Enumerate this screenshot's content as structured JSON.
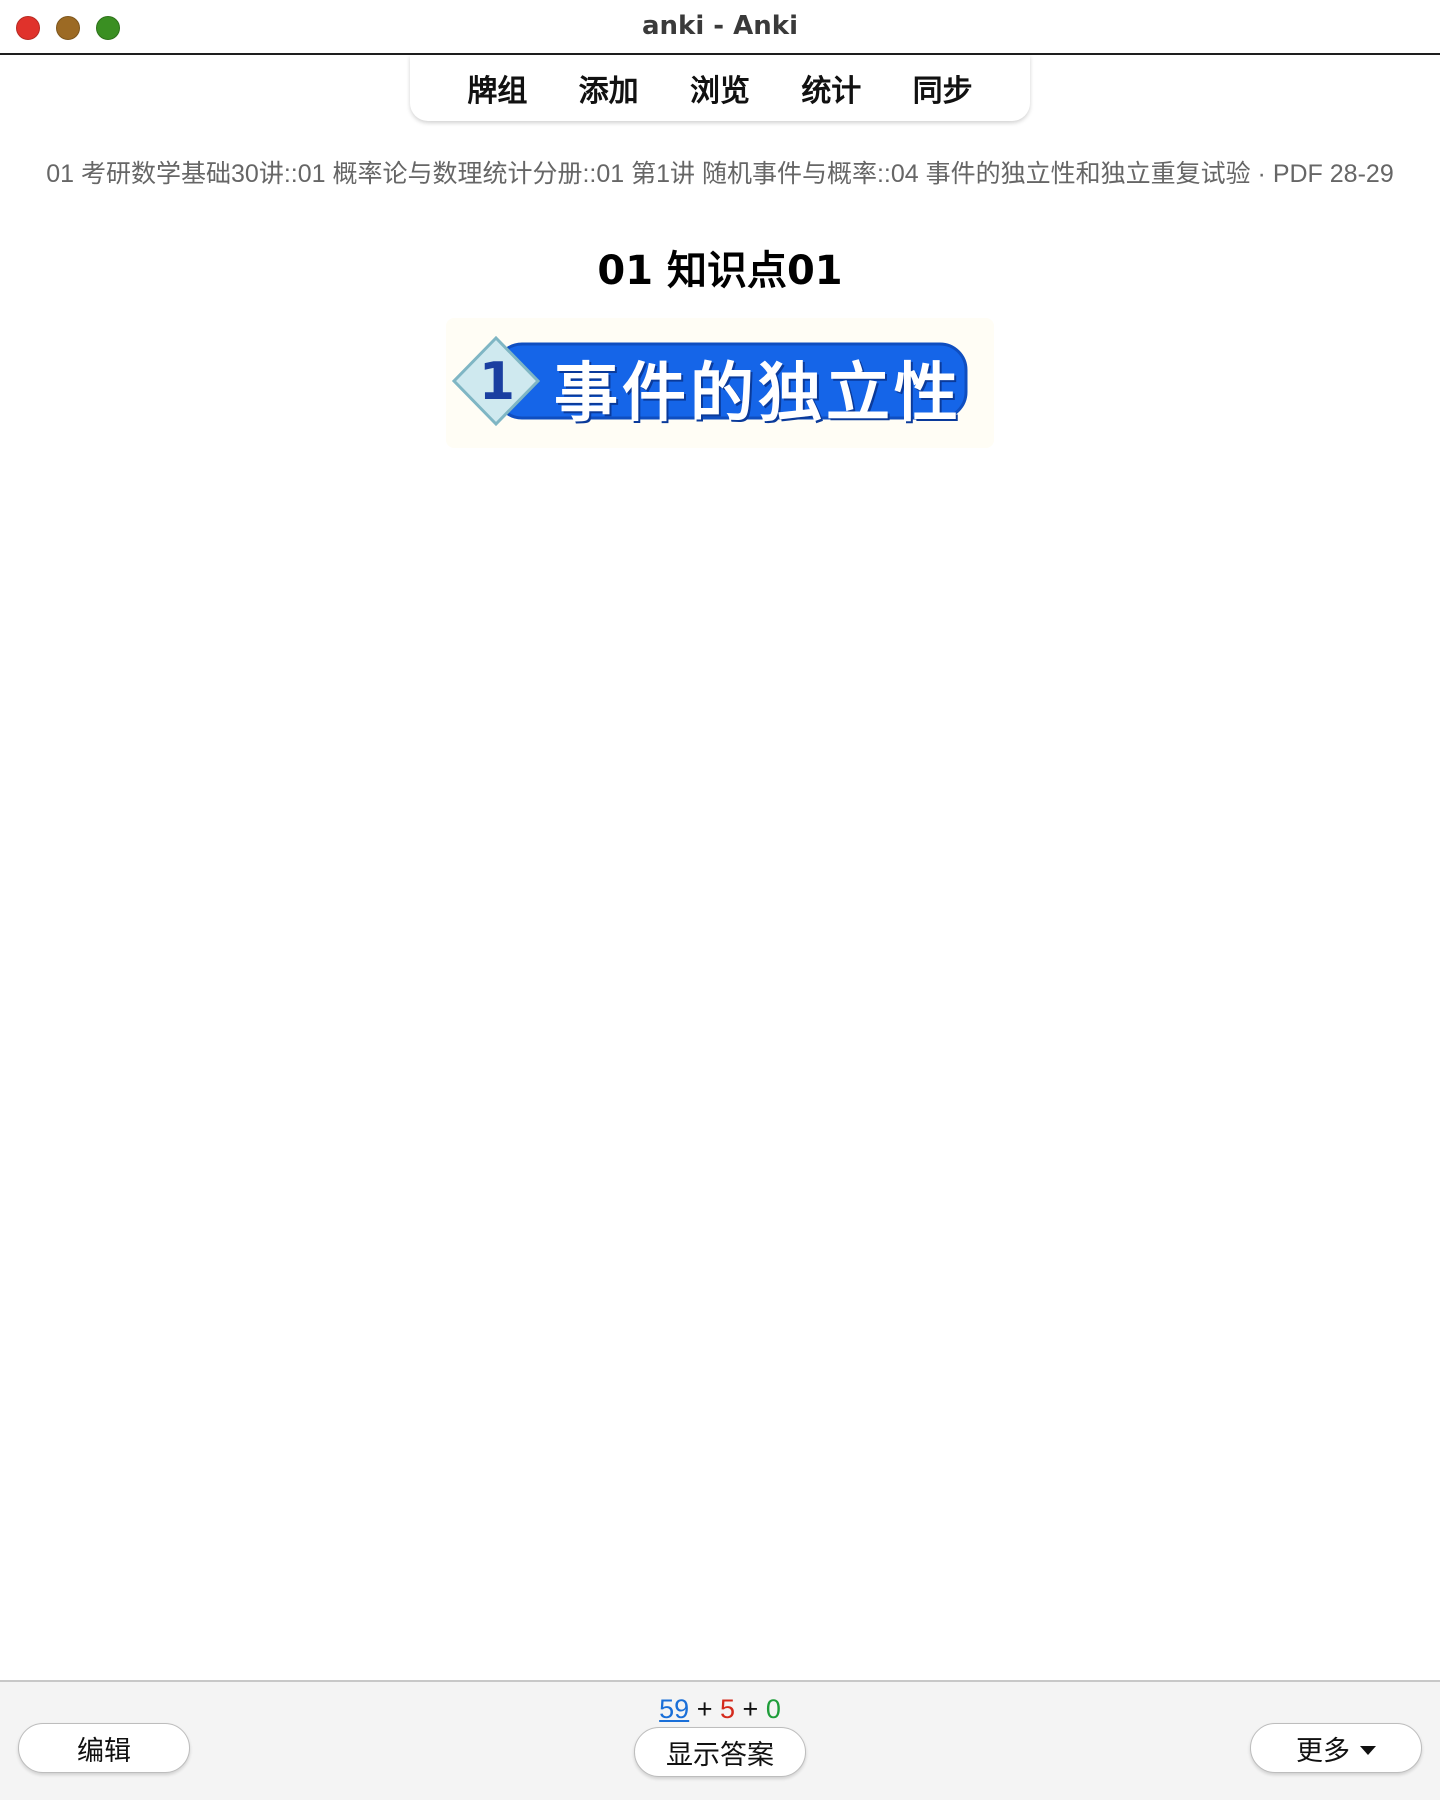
{
  "window": {
    "title": "anki - Anki"
  },
  "toolbar": {
    "items": [
      {
        "label": "牌组"
      },
      {
        "label": "添加"
      },
      {
        "label": "浏览"
      },
      {
        "label": "统计"
      },
      {
        "label": "同步"
      }
    ]
  },
  "card": {
    "deck_path": "01 考研数学基础30讲::01 概率论与数理统计分册::01 第1讲 随机事件与概率::04 事件的独立性和独立重复试验 · PDF 28-29",
    "title": "01 知识点01",
    "banner": {
      "number": "1",
      "text": "事件的独立性",
      "color": "#1565e8"
    }
  },
  "bottom": {
    "counts": {
      "new": "59",
      "learning": "5",
      "review": "0",
      "separator": "+"
    },
    "edit_label": "编辑",
    "show_answer_label": "显示答案",
    "more_label": "更多"
  },
  "colors": {
    "new_count": "#1a6fd8",
    "learning_count": "#d42a1c",
    "review_count": "#1f9d3a",
    "close": "#e0322b",
    "minimize": "#9c6a24",
    "zoom": "#3a8f22"
  }
}
